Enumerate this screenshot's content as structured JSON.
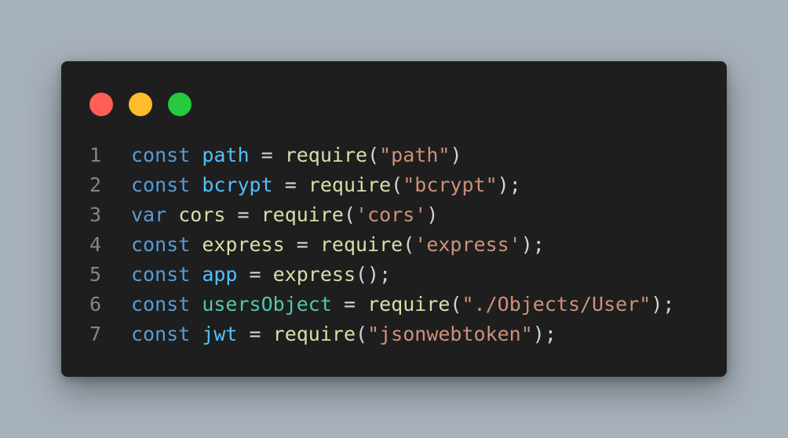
{
  "colors": {
    "background": "#a7b1bb",
    "window": "#1e1e1e",
    "line_number": "#858585",
    "keyword": "#569cd6",
    "variable": "#4fc1ff",
    "variable_plain": "#dcdcaa",
    "constant_class": "#4ec9b0",
    "function": "#dcdcaa",
    "string": "#ce9178",
    "punctuation": "#d4d4d4"
  },
  "window_controls": [
    {
      "name": "close",
      "color": "#ff5f56"
    },
    {
      "name": "minimize",
      "color": "#ffbd2e"
    },
    {
      "name": "maximize",
      "color": "#27c93f"
    }
  ],
  "code": {
    "lines": [
      {
        "number": "1",
        "tokens": [
          {
            "text": "const",
            "type": "keyword"
          },
          {
            "text": " ",
            "type": "punctuation"
          },
          {
            "text": "path",
            "type": "variable"
          },
          {
            "text": " = ",
            "type": "punctuation"
          },
          {
            "text": "require",
            "type": "function"
          },
          {
            "text": "(",
            "type": "punctuation"
          },
          {
            "text": "\"path\"",
            "type": "string"
          },
          {
            "text": ")",
            "type": "punctuation"
          }
        ]
      },
      {
        "number": "2",
        "tokens": [
          {
            "text": "const",
            "type": "keyword"
          },
          {
            "text": " ",
            "type": "punctuation"
          },
          {
            "text": "bcrypt",
            "type": "variable"
          },
          {
            "text": " = ",
            "type": "punctuation"
          },
          {
            "text": "require",
            "type": "function"
          },
          {
            "text": "(",
            "type": "punctuation"
          },
          {
            "text": "\"bcrypt\"",
            "type": "string"
          },
          {
            "text": ");",
            "type": "punctuation"
          }
        ]
      },
      {
        "number": "3",
        "tokens": [
          {
            "text": "var",
            "type": "keyword"
          },
          {
            "text": " ",
            "type": "punctuation"
          },
          {
            "text": "cors",
            "type": "variable_plain"
          },
          {
            "text": " = ",
            "type": "punctuation"
          },
          {
            "text": "require",
            "type": "function"
          },
          {
            "text": "(",
            "type": "punctuation"
          },
          {
            "text": "'cors'",
            "type": "string"
          },
          {
            "text": ")",
            "type": "punctuation"
          }
        ]
      },
      {
        "number": "4",
        "tokens": [
          {
            "text": "const",
            "type": "keyword"
          },
          {
            "text": " ",
            "type": "punctuation"
          },
          {
            "text": "express",
            "type": "variable_plain"
          },
          {
            "text": " = ",
            "type": "punctuation"
          },
          {
            "text": "require",
            "type": "function"
          },
          {
            "text": "(",
            "type": "punctuation"
          },
          {
            "text": "'express'",
            "type": "string"
          },
          {
            "text": ");",
            "type": "punctuation"
          }
        ]
      },
      {
        "number": "5",
        "tokens": [
          {
            "text": "const",
            "type": "keyword"
          },
          {
            "text": " ",
            "type": "punctuation"
          },
          {
            "text": "app",
            "type": "variable"
          },
          {
            "text": " = ",
            "type": "punctuation"
          },
          {
            "text": "express",
            "type": "function"
          },
          {
            "text": "();",
            "type": "punctuation"
          }
        ]
      },
      {
        "number": "6",
        "tokens": [
          {
            "text": "const",
            "type": "keyword"
          },
          {
            "text": " ",
            "type": "punctuation"
          },
          {
            "text": "usersObject",
            "type": "constant_class"
          },
          {
            "text": " = ",
            "type": "punctuation"
          },
          {
            "text": "require",
            "type": "function"
          },
          {
            "text": "(",
            "type": "punctuation"
          },
          {
            "text": "\"./Objects/User\"",
            "type": "string"
          },
          {
            "text": ");",
            "type": "punctuation"
          }
        ]
      },
      {
        "number": "7",
        "tokens": [
          {
            "text": "const",
            "type": "keyword"
          },
          {
            "text": " ",
            "type": "punctuation"
          },
          {
            "text": "jwt",
            "type": "variable"
          },
          {
            "text": " = ",
            "type": "punctuation"
          },
          {
            "text": "require",
            "type": "function"
          },
          {
            "text": "(",
            "type": "punctuation"
          },
          {
            "text": "\"jsonwebtoken\"",
            "type": "string"
          },
          {
            "text": ");",
            "type": "punctuation"
          }
        ]
      }
    ]
  }
}
